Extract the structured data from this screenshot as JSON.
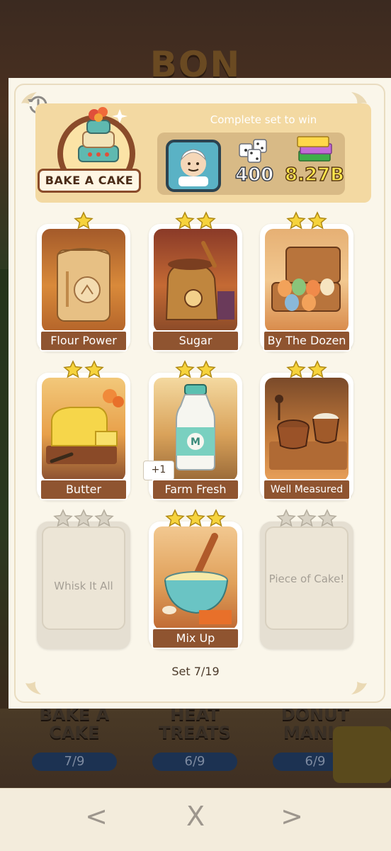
{
  "background": {
    "logo_text": "BON",
    "sets": [
      {
        "title": "BAKE A CAKE",
        "progress": "7/9"
      },
      {
        "title": "HEAT TREATS",
        "progress": "6/9"
      },
      {
        "title": "DONUT MANIA",
        "progress": "6/9"
      }
    ]
  },
  "set": {
    "name": "BAKE A CAKE",
    "complete_prompt": "Complete set to win",
    "rewards": {
      "dice": "400",
      "money": "8.27B"
    },
    "counter": "Set 7/19"
  },
  "cards": [
    {
      "name": "Flour Power",
      "stars": 1,
      "collected": true
    },
    {
      "name": "Sugar",
      "stars": 2,
      "collected": true
    },
    {
      "name": "By The Dozen",
      "stars": 2,
      "collected": true
    },
    {
      "name": "Butter",
      "stars": 2,
      "collected": true
    },
    {
      "name": "Farm Fresh",
      "stars": 2,
      "collected": true,
      "extra": "+1"
    },
    {
      "name": "Well Measured",
      "stars": 2,
      "collected": true
    },
    {
      "name": "Whisk It All",
      "stars": 3,
      "collected": false
    },
    {
      "name": "Mix Up",
      "stars": 3,
      "collected": true
    },
    {
      "name": "Piece of Cake!",
      "stars": 3,
      "collected": false
    }
  ],
  "nav": {
    "prev": "<",
    "close": "X",
    "next": ">"
  },
  "colors": {
    "star_filled": "#f6d33c",
    "star_empty": "#d8d2c4",
    "label_brown": "#8f5430",
    "header": "#f3d9a2"
  }
}
